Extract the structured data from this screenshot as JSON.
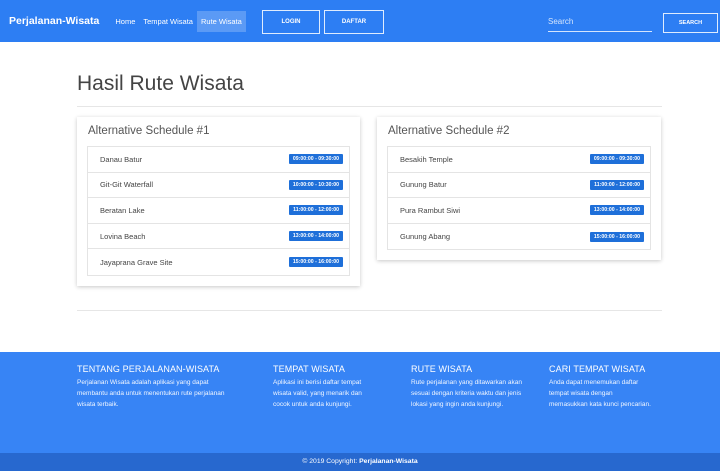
{
  "navbar": {
    "brand": "Perjalanan-Wisata",
    "links": [
      "Home",
      "Tempat Wisata",
      "Rute Wisata"
    ],
    "login_label": "LOGIN",
    "daftar_label": "DAFTAR",
    "search_placeholder": "Search",
    "search_button_label": "SEARCH"
  },
  "page": {
    "title": "Hasil Rute Wisata"
  },
  "schedules": [
    {
      "title": "Alternative Schedule #1",
      "items": [
        {
          "name": "Danau Batur",
          "time": "09:00:00 - 09:30:00"
        },
        {
          "name": "Git-Git Waterfall",
          "time": "10:00:00 - 10:30:00"
        },
        {
          "name": "Beratan Lake",
          "time": "11:00:00 - 12:00:00"
        },
        {
          "name": "Lovina Beach",
          "time": "13:00:00 - 14:00:00"
        },
        {
          "name": "Jayaprana Grave Site",
          "time": "15:00:00 - 16:00:00"
        }
      ]
    },
    {
      "title": "Alternative Schedule #2",
      "items": [
        {
          "name": "Besakih Temple",
          "time": "09:00:00 - 09:30:00"
        },
        {
          "name": "Gunung Batur",
          "time": "11:00:00 - 12:00:00"
        },
        {
          "name": "Pura Rambut Siwi",
          "time": "13:00:00 - 14:00:00"
        },
        {
          "name": "Gunung Abang",
          "time": "15:00:00 - 16:00:00"
        }
      ]
    }
  ],
  "footer": {
    "columns": [
      {
        "title": "TENTANG PERJALANAN-WISATA",
        "text": "Perjalanan Wisata adalah aplikasi yang dapat membantu anda untuk menentukan rute perjalanan wisata terbaik."
      },
      {
        "title": "TEMPAT WISATA",
        "text": "Aplikasi ini berisi daftar tempat wisata valid, yang menarik dan cocok untuk anda kunjungi."
      },
      {
        "title": "RUTE WISATA",
        "text": "Rute perjalanan yang ditawarkan akan sesuai dengan kriteria waktu dan jenis lokasi yang ingin anda kunjungi."
      },
      {
        "title": "CARI TEMPAT WISATA",
        "text": "Anda dapat menemukan daftar tempat wisata dengan memasukkan kata kunci pencarian."
      }
    ],
    "copyright_prefix": "© 2019 Copyright: ",
    "copyright_brand": "Perjalanan-Wisata"
  },
  "colors": {
    "primary": "#2d7ef3",
    "footer": "#3784f5",
    "copyright_bar": "#2768cf",
    "badge": "#1e6fd9"
  }
}
